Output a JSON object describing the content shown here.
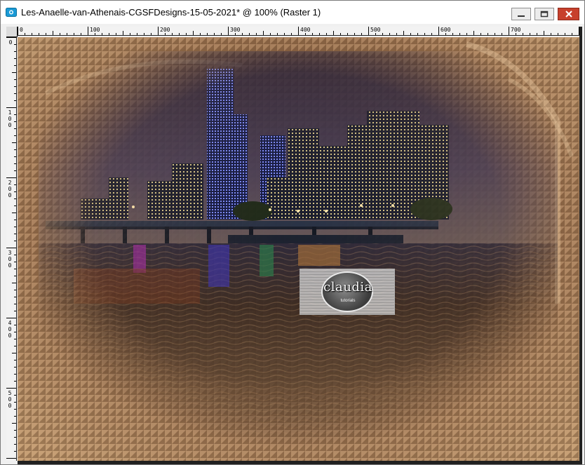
{
  "window": {
    "title": "Les-Anaelle-van-Athenais-CGSFDesigns-15-05-2021* @ 100% (Raster 1)",
    "controls": [
      "minimize",
      "maximize",
      "close"
    ]
  },
  "ruler": {
    "top_labels": [
      "0",
      "100",
      "200",
      "300",
      "400",
      "500",
      "600",
      "700"
    ],
    "left_labels": [
      "0",
      "100",
      "200",
      "300",
      "400",
      "500"
    ]
  },
  "canvas": {
    "description_colors": {
      "frame": "#b08258",
      "water_dark": "#2b2420",
      "sky": "#3b3350"
    }
  },
  "watermark": {
    "name": "claudia",
    "tagline": "tutorials"
  }
}
